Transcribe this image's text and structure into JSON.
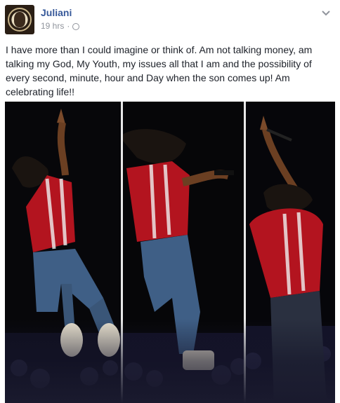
{
  "post": {
    "author": "Juliani",
    "time": "19 hrs",
    "separator": "·",
    "body": "I have more than I could imagine or think of. Am not talking money, am talking my God, My Youth, my issues all that I am and the possibility of every second, minute, hour and Day when the son comes up! Am celebrating life!!"
  },
  "icons": {
    "menu": "chevron-down-icon",
    "audience": "globe-icon"
  },
  "colors": {
    "author_link": "#365899",
    "meta": "#90949c",
    "shirt": "#b3141f",
    "jeans": "#3f5f86"
  }
}
